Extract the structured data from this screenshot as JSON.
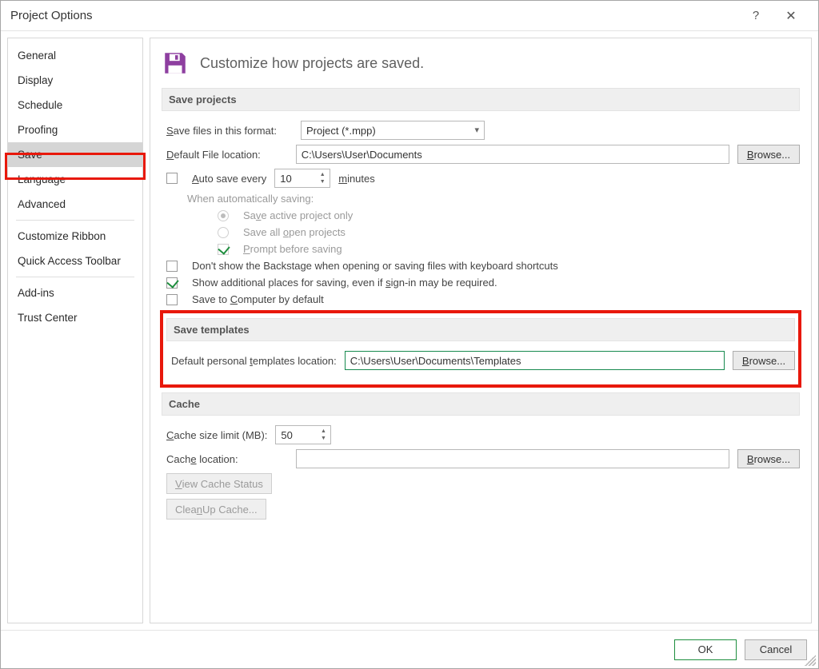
{
  "window": {
    "title": "Project Options"
  },
  "sidebar": {
    "selected": "Save",
    "groups": [
      [
        "General",
        "Display",
        "Schedule",
        "Proofing",
        "Save",
        "Language",
        "Advanced"
      ],
      [
        "Customize Ribbon",
        "Quick Access Toolbar"
      ],
      [
        "Add-ins",
        "Trust Center"
      ]
    ]
  },
  "page": {
    "heading": "Customize how projects are saved."
  },
  "save_projects": {
    "section": "Save projects",
    "format_label_pre": "S",
    "format_label_post": "ave files in this format:",
    "format_value": "Project (*.mpp)",
    "default_location_label_pre": "D",
    "default_location_label_post": "efault File location:",
    "default_location_value": "C:\\Users\\User\\Documents",
    "browse": "Browse...",
    "browse_u": "B",
    "autosave_pre": "A",
    "autosave_post": "uto save every",
    "autosave_value": "10",
    "minutes_pre": "m",
    "minutes_post": "inutes",
    "when_auto": "When automatically saving:",
    "radio_active_pre": "Sa",
    "radio_active_u": "v",
    "radio_active_post": "e active project only",
    "radio_all_pre": "Save all ",
    "radio_all_u": "o",
    "radio_all_post": "pen projects",
    "prompt_pre": "P",
    "prompt_post": "rompt before saving",
    "backstage": "Don't show the Backstage when opening or saving files with keyboard shortcuts",
    "additional_pre": "Show additional places for saving, even if ",
    "additional_u": "s",
    "additional_post": "ign-in may be required.",
    "computer_pre": "Save to ",
    "computer_u": "C",
    "computer_post": "omputer by default"
  },
  "save_templates": {
    "section": "Save templates",
    "label_pre": "Default personal ",
    "label_u": "t",
    "label_post": "emplates location:",
    "value": "C:\\Users\\User\\Documents\\Templates",
    "browse": "Browse...",
    "browse_u": "B"
  },
  "cache": {
    "section": "Cache",
    "size_label_pre": "C",
    "size_label_post": "ache size limit (MB):",
    "size_value": "50",
    "loc_label_pre": "Cach",
    "loc_label_u": "e",
    "loc_label_post": " location:",
    "loc_value": "",
    "browse": "Browse...",
    "browse_u": "B",
    "view_status_pre": "V",
    "view_status_post": "iew Cache Status",
    "cleanup_pre": "Clea",
    "cleanup_u": "n",
    "cleanup_post": " Up Cache..."
  },
  "footer": {
    "ok": "OK",
    "cancel": "Cancel"
  }
}
